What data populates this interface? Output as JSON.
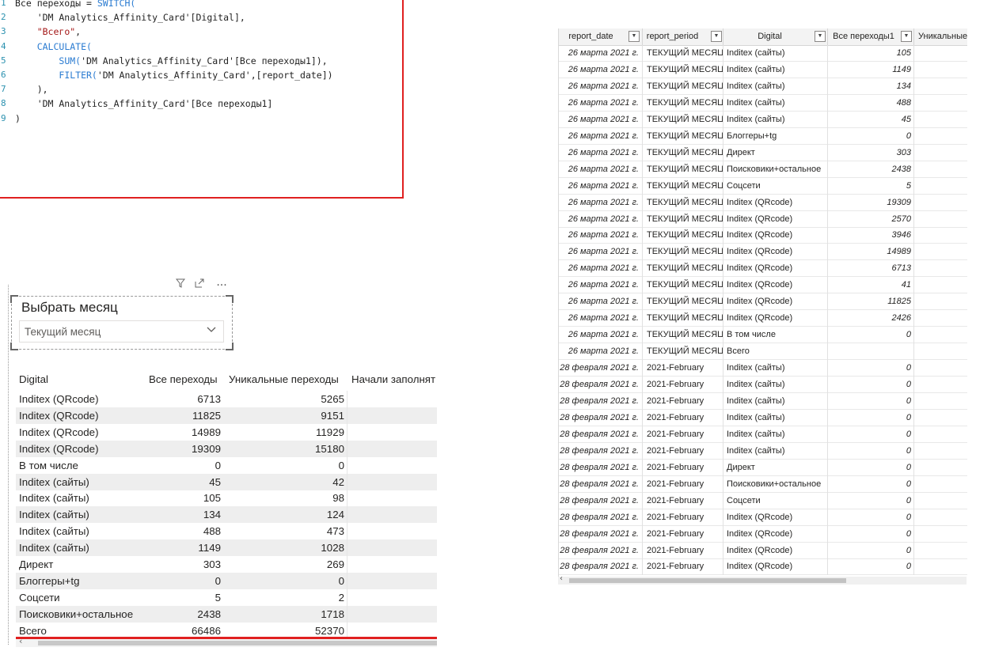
{
  "code_editor": {
    "lines": [
      {
        "num": "1",
        "parts": [
          {
            "t": "Все переходы = ",
            "c": "plain"
          },
          {
            "t": "SWITCH(",
            "c": "kw"
          }
        ]
      },
      {
        "num": "2",
        "parts": [
          {
            "t": "    'DM Analytics_Affinity_Card'[Digital],",
            "c": "plain"
          }
        ]
      },
      {
        "num": "3",
        "parts": [
          {
            "t": "    ",
            "c": "plain"
          },
          {
            "t": "\"Всего\"",
            "c": "str"
          },
          {
            "t": ",",
            "c": "plain"
          }
        ]
      },
      {
        "num": "4",
        "parts": [
          {
            "t": "    ",
            "c": "plain"
          },
          {
            "t": "CALCULATE(",
            "c": "kw"
          }
        ]
      },
      {
        "num": "5",
        "parts": [
          {
            "t": "        ",
            "c": "plain"
          },
          {
            "t": "SUM(",
            "c": "kw"
          },
          {
            "t": "'DM Analytics_Affinity_Card'[Все переходы1]),",
            "c": "plain"
          }
        ]
      },
      {
        "num": "6",
        "parts": [
          {
            "t": "        ",
            "c": "plain"
          },
          {
            "t": "FILTER(",
            "c": "kw"
          },
          {
            "t": "'DM Analytics_Affinity_Card',[report_date])",
            "c": "plain"
          }
        ]
      },
      {
        "num": "7",
        "parts": [
          {
            "t": "    ),",
            "c": "plain"
          }
        ]
      },
      {
        "num": "8",
        "parts": [
          {
            "t": "    'DM Analytics_Affinity_Card'[Все переходы1]",
            "c": "plain"
          }
        ]
      },
      {
        "num": "9",
        "parts": [
          {
            "t": ")",
            "c": "plain"
          }
        ]
      }
    ]
  },
  "slicer": {
    "title": "Выбрать месяц",
    "selected": "Текущий месяц",
    "toolbar_icons": [
      "filter-icon",
      "focus-mode-icon",
      "more-options-icon"
    ]
  },
  "report_table": {
    "headers": [
      "Digital",
      "Все переходы",
      "Уникальные переходы",
      "Начали заполнят"
    ],
    "rows": [
      {
        "digital": "Inditex (QRcode)",
        "all": "6713",
        "unique": "5265"
      },
      {
        "digital": "Inditex (QRcode)",
        "all": "11825",
        "unique": "9151"
      },
      {
        "digital": "Inditex (QRcode)",
        "all": "14989",
        "unique": "11929"
      },
      {
        "digital": "Inditex (QRcode)",
        "all": "19309",
        "unique": "15180"
      },
      {
        "digital": "В том числе",
        "all": "0",
        "unique": "0"
      },
      {
        "digital": "Inditex (сайты)",
        "all": "45",
        "unique": "42"
      },
      {
        "digital": "Inditex (сайты)",
        "all": "105",
        "unique": "98"
      },
      {
        "digital": "Inditex (сайты)",
        "all": "134",
        "unique": "124"
      },
      {
        "digital": "Inditex (сайты)",
        "all": "488",
        "unique": "473"
      },
      {
        "digital": "Inditex (сайты)",
        "all": "1149",
        "unique": "1028"
      },
      {
        "digital": "Директ",
        "all": "303",
        "unique": "269"
      },
      {
        "digital": "Блоггеры+tg",
        "all": "0",
        "unique": "0"
      },
      {
        "digital": "Соцсети",
        "all": "5",
        "unique": "2"
      },
      {
        "digital": "Поисковики+остальное",
        "all": "2438",
        "unique": "1718"
      }
    ],
    "total": {
      "digital": "Всего",
      "all": "66486",
      "unique": "52370"
    }
  },
  "data_grid": {
    "headers": [
      "report_date",
      "report_period",
      "Digital",
      "Все переходы1",
      "Уникальные"
    ],
    "rows": [
      [
        "26 марта 2021 г.",
        "ТЕКУЩИЙ МЕСЯЦ",
        "Inditex (сайты)",
        "105"
      ],
      [
        "26 марта 2021 г.",
        "ТЕКУЩИЙ МЕСЯЦ",
        "Inditex (сайты)",
        "1149"
      ],
      [
        "26 марта 2021 г.",
        "ТЕКУЩИЙ МЕСЯЦ",
        "Inditex (сайты)",
        "134"
      ],
      [
        "26 марта 2021 г.",
        "ТЕКУЩИЙ МЕСЯЦ",
        "Inditex (сайты)",
        "488"
      ],
      [
        "26 марта 2021 г.",
        "ТЕКУЩИЙ МЕСЯЦ",
        "Inditex (сайты)",
        "45"
      ],
      [
        "26 марта 2021 г.",
        "ТЕКУЩИЙ МЕСЯЦ",
        "Блоггеры+tg",
        "0"
      ],
      [
        "26 марта 2021 г.",
        "ТЕКУЩИЙ МЕСЯЦ",
        "Директ",
        "303"
      ],
      [
        "26 марта 2021 г.",
        "ТЕКУЩИЙ МЕСЯЦ",
        "Поисковики+остальное",
        "2438"
      ],
      [
        "26 марта 2021 г.",
        "ТЕКУЩИЙ МЕСЯЦ",
        "Соцсети",
        "5"
      ],
      [
        "26 марта 2021 г.",
        "ТЕКУЩИЙ МЕСЯЦ",
        "Inditex (QRcode)",
        "19309"
      ],
      [
        "26 марта 2021 г.",
        "ТЕКУЩИЙ МЕСЯЦ",
        "Inditex (QRcode)",
        "2570"
      ],
      [
        "26 марта 2021 г.",
        "ТЕКУЩИЙ МЕСЯЦ",
        "Inditex (QRcode)",
        "3946"
      ],
      [
        "26 марта 2021 г.",
        "ТЕКУЩИЙ МЕСЯЦ",
        "Inditex (QRcode)",
        "14989"
      ],
      [
        "26 марта 2021 г.",
        "ТЕКУЩИЙ МЕСЯЦ",
        "Inditex (QRcode)",
        "6713"
      ],
      [
        "26 марта 2021 г.",
        "ТЕКУЩИЙ МЕСЯЦ",
        "Inditex (QRcode)",
        "41"
      ],
      [
        "26 марта 2021 г.",
        "ТЕКУЩИЙ МЕСЯЦ",
        "Inditex (QRcode)",
        "11825"
      ],
      [
        "26 марта 2021 г.",
        "ТЕКУЩИЙ МЕСЯЦ",
        "Inditex (QRcode)",
        "2426"
      ],
      [
        "26 марта 2021 г.",
        "ТЕКУЩИЙ МЕСЯЦ",
        "В том числе",
        "0"
      ],
      [
        "26 марта 2021 г.",
        "ТЕКУЩИЙ МЕСЯЦ",
        "Всего",
        ""
      ],
      [
        "28 февраля 2021 г.",
        "2021-February",
        "Inditex (сайты)",
        "0"
      ],
      [
        "28 февраля 2021 г.",
        "2021-February",
        "Inditex (сайты)",
        "0"
      ],
      [
        "28 февраля 2021 г.",
        "2021-February",
        "Inditex (сайты)",
        "0"
      ],
      [
        "28 февраля 2021 г.",
        "2021-February",
        "Inditex (сайты)",
        "0"
      ],
      [
        "28 февраля 2021 г.",
        "2021-February",
        "Inditex (сайты)",
        "0"
      ],
      [
        "28 февраля 2021 г.",
        "2021-February",
        "Inditex (сайты)",
        "0"
      ],
      [
        "28 февраля 2021 г.",
        "2021-February",
        "Директ",
        "0"
      ],
      [
        "28 февраля 2021 г.",
        "2021-February",
        "Поисковики+остальное",
        "0"
      ],
      [
        "28 февраля 2021 г.",
        "2021-February",
        "Соцсети",
        "0"
      ],
      [
        "28 февраля 2021 г.",
        "2021-February",
        "Inditex (QRcode)",
        "0"
      ],
      [
        "28 февраля 2021 г.",
        "2021-February",
        "Inditex (QRcode)",
        "0"
      ],
      [
        "28 февраля 2021 г.",
        "2021-February",
        "Inditex (QRcode)",
        "0"
      ],
      [
        "28 февраля 2021 г.",
        "2021-February",
        "Inditex (QRcode)",
        "0"
      ]
    ]
  },
  "colors": {
    "highlight_border": "#e02020",
    "dax_keyword": "#2a7bd1",
    "dax_string": "#a31515",
    "line_number": "#2b91af",
    "table_stripe": "#eeeeee"
  }
}
